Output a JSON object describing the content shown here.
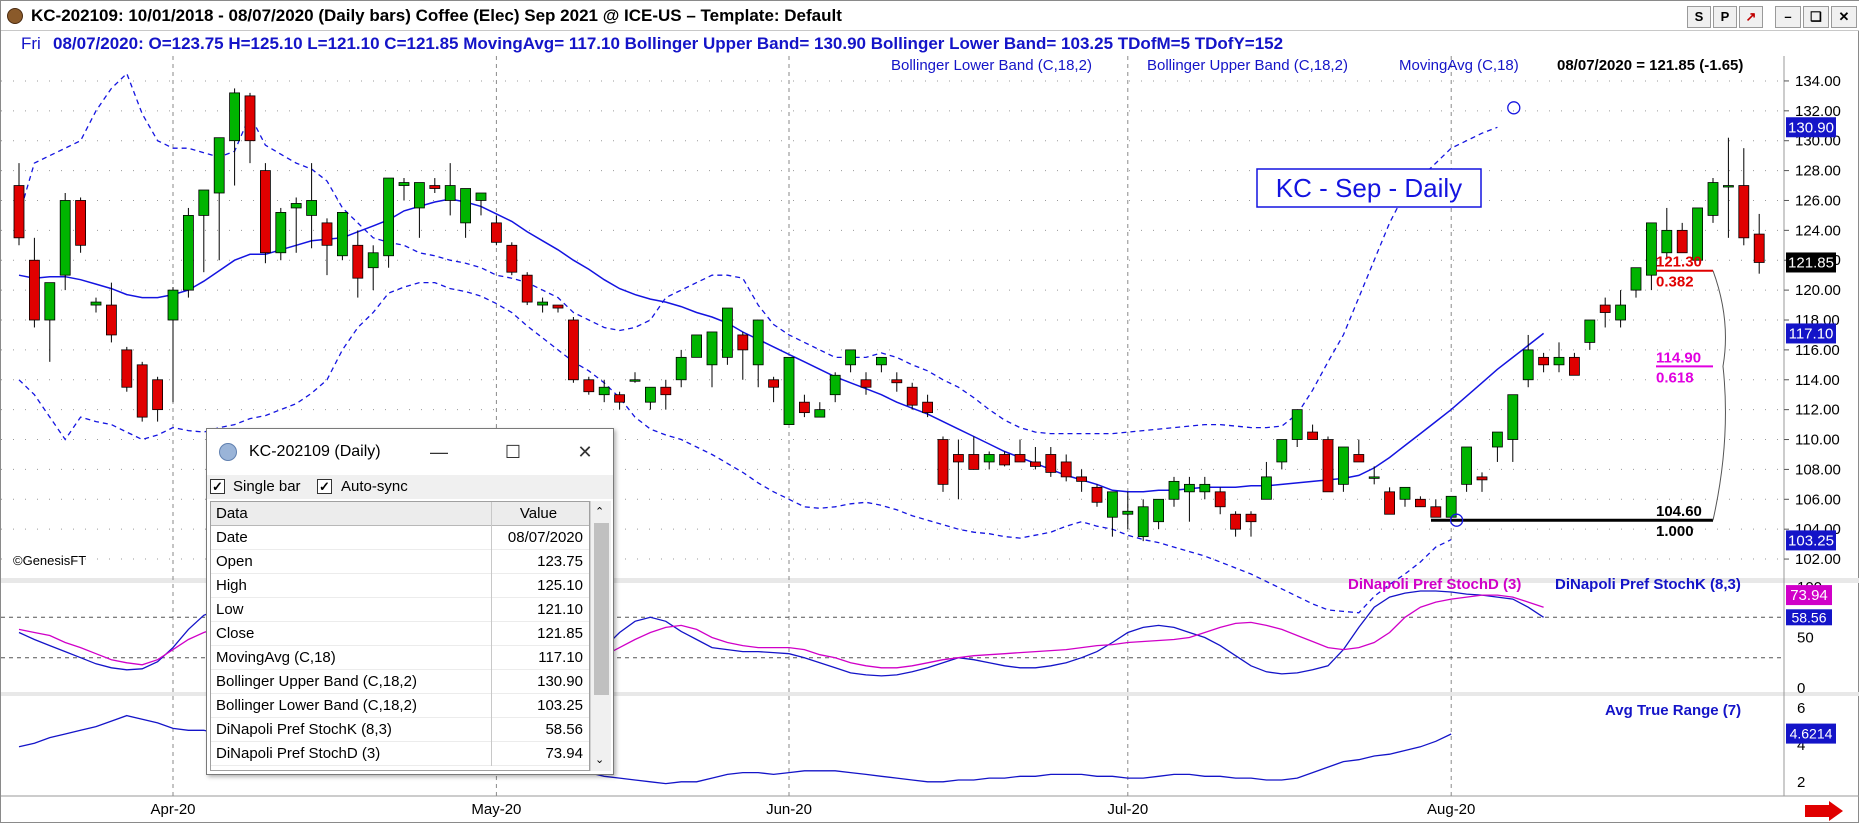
{
  "window": {
    "title": "KC-202109:  10/01/2018 - 08/07/2020  (Daily bars)   Coffee (Elec) Sep 2021 @ ICE-US  –  Template: Default",
    "buttons": [
      "S",
      "P",
      "↗",
      "–",
      "❏",
      "✕"
    ]
  },
  "infobar": {
    "day": "Fri",
    "text": "08/07/2020:  O=123.75  H=125.10  L=121.10  C=121.85  MovingAvg= 117.10  Bollinger Upper Band= 130.90  Bollinger Lower Band= 103.25  TDofM=5  TDofY=152"
  },
  "chart_data": {
    "type": "candlestick",
    "title": "KC - Sep - Daily",
    "watermark": "©GenesisFT",
    "legend": [
      "Bollinger Lower Band (C,18,2)",
      "Bollinger Upper Band (C,18,2)",
      "MovingAvg (C,18)"
    ],
    "last_label": "08/07/2020 = 121.85 (-1.65)",
    "x_labels": [
      {
        "i": 10,
        "label": "Apr-20"
      },
      {
        "i": 31,
        "label": "May-20"
      },
      {
        "i": 50,
        "label": "Jun-20"
      },
      {
        "i": 72,
        "label": "Jul-20"
      },
      {
        "i": 93,
        "label": "Aug-20"
      }
    ],
    "y_ticks": [
      102,
      104,
      106,
      108,
      110,
      112,
      114,
      116,
      118,
      120,
      122,
      124,
      126,
      128,
      130,
      132,
      134
    ],
    "ylim": [
      101,
      135
    ],
    "ohlc": [
      [
        127,
        128.5,
        123,
        123.5
      ],
      [
        122,
        123.5,
        117.5,
        118
      ],
      [
        118,
        119.5,
        115.2,
        120.5
      ],
      [
        121,
        126.5,
        120,
        126
      ],
      [
        126,
        126.2,
        122.5,
        123
      ],
      [
        119,
        119.5,
        118.5,
        119.2
      ],
      [
        119,
        120.5,
        116.5,
        117
      ],
      [
        116,
        116.2,
        113.2,
        113.5
      ],
      [
        115,
        115.2,
        111.2,
        111.5
      ],
      [
        114,
        114.2,
        111.2,
        112
      ],
      [
        118,
        120.2,
        112.5,
        120
      ],
      [
        120,
        125.5,
        119.5,
        125
      ],
      [
        125,
        126.5,
        121.2,
        126.7
      ],
      [
        126.5,
        128.5,
        122,
        130.2
      ],
      [
        130,
        133.5,
        127,
        133.2
      ],
      [
        133,
        133.2,
        128.5,
        130
      ],
      [
        128,
        128.5,
        121.8,
        122.5
      ],
      [
        122.5,
        125.5,
        122,
        125.2
      ],
      [
        125.5,
        126.2,
        122.5,
        125.8
      ],
      [
        125,
        128.5,
        122.8,
        126
      ],
      [
        124.5,
        124.8,
        121,
        123
      ],
      [
        122.3,
        124.5,
        122,
        125.2
      ],
      [
        123,
        124,
        119.5,
        120.8
      ],
      [
        121.5,
        123,
        120,
        122.5
      ],
      [
        122.3,
        124.5,
        121.5,
        127.5
      ],
      [
        127,
        127.5,
        126,
        127.2
      ],
      [
        125.5,
        127,
        123.5,
        127.2
      ],
      [
        127,
        127.5,
        126.5,
        126.8
      ],
      [
        126,
        128.5,
        125,
        127
      ],
      [
        124.5,
        126.5,
        123.5,
        126.8
      ],
      [
        126,
        126.2,
        125,
        126.5
      ],
      [
        124.5,
        125,
        123,
        123.2
      ],
      [
        123,
        123.2,
        121,
        121.2
      ],
      [
        121,
        121.2,
        119,
        119.2
      ],
      [
        119,
        119.5,
        118.5,
        119.2
      ],
      [
        119,
        119,
        118.5,
        118.8
      ],
      [
        118,
        118.2,
        113.8,
        114
      ],
      [
        114,
        114.2,
        113,
        113.2
      ],
      [
        113,
        114,
        112.5,
        113.5
      ],
      [
        113,
        113.2,
        112,
        112.5
      ],
      [
        114,
        114.5,
        113.8,
        114
      ],
      [
        112.5,
        113.5,
        112,
        113.5
      ],
      [
        113.5,
        114,
        112,
        113
      ],
      [
        114,
        116,
        113.5,
        115.5
      ],
      [
        115.5,
        116.5,
        116,
        117
      ],
      [
        115,
        116,
        113.5,
        117.2
      ],
      [
        115.5,
        118.5,
        115,
        118.8
      ],
      [
        117,
        117.2,
        114,
        116
      ],
      [
        115,
        115.2,
        113.5,
        118
      ],
      [
        114,
        114.2,
        112.5,
        113.5
      ],
      [
        111,
        113,
        111,
        115.5
      ],
      [
        112.5,
        113,
        111.5,
        111.8
      ],
      [
        111.5,
        112.5,
        111.5,
        112
      ],
      [
        113,
        114.5,
        112.5,
        114.3
      ],
      [
        115,
        115.5,
        114.5,
        116
      ],
      [
        114,
        114.5,
        113,
        113.5
      ],
      [
        115,
        115.5,
        114.5,
        115.5
      ],
      [
        114,
        114.5,
        113.2,
        113.8
      ],
      [
        113.5,
        113.8,
        112,
        112.3
      ],
      [
        112.5,
        113,
        111.5,
        111.8
      ],
      [
        110,
        110.2,
        106.5,
        107
      ],
      [
        109,
        110,
        106,
        108.5
      ],
      [
        109,
        110.2,
        108,
        108
      ],
      [
        108.5,
        109.2,
        108,
        109
      ],
      [
        109,
        109.2,
        108.2,
        108.3
      ],
      [
        109,
        110,
        108.5,
        108.5
      ],
      [
        108.5,
        109.5,
        108,
        108.2
      ],
      [
        109,
        109.5,
        107.5,
        107.8
      ],
      [
        108.5,
        109,
        107.2,
        107.5
      ],
      [
        107.5,
        108,
        106.5,
        107.2
      ],
      [
        106.8,
        107,
        105.5,
        105.8
      ],
      [
        104.8,
        106,
        103.5,
        106.5
      ],
      [
        105,
        106.5,
        104,
        105.2
      ],
      [
        103.5,
        106,
        103.2,
        105.5
      ],
      [
        104.5,
        105.5,
        104,
        106
      ],
      [
        106,
        107.5,
        105.5,
        107.2
      ],
      [
        106.5,
        107.5,
        104.5,
        107
      ],
      [
        106.5,
        107.5,
        106,
        107
      ],
      [
        106.5,
        106.8,
        105,
        105.5
      ],
      [
        105,
        105.2,
        103.5,
        104
      ],
      [
        105,
        105.2,
        103.5,
        104.5
      ],
      [
        106,
        108.5,
        106,
        107.5
      ],
      [
        108.5,
        109,
        108,
        110
      ],
      [
        110,
        111.5,
        109.5,
        112
      ],
      [
        110.5,
        111,
        110,
        110
      ],
      [
        110,
        110.2,
        106.5,
        106.5
      ],
      [
        107,
        109.5,
        106.5,
        109.5
      ],
      [
        109,
        110,
        108.5,
        108.5
      ],
      [
        107.5,
        108.2,
        107,
        107.5
      ],
      [
        106.5,
        106.8,
        105.5,
        105
      ],
      [
        106,
        106.5,
        105.5,
        106.8
      ],
      [
        106,
        106.2,
        105.5,
        105.5
      ],
      [
        105.5,
        106,
        104.8,
        104.8
      ],
      [
        104.8,
        106,
        104.6,
        106.2
      ],
      [
        107,
        108.5,
        106.5,
        109.5
      ],
      [
        107.5,
        107.8,
        106.5,
        107.3
      ],
      [
        109.5,
        110.5,
        108.5,
        110.5
      ],
      [
        110,
        111,
        108.5,
        113
      ],
      [
        114,
        117,
        113.5,
        116
      ],
      [
        115.5,
        115.8,
        114.5,
        115
      ],
      [
        115,
        116.5,
        114.5,
        115.5
      ],
      [
        115.5,
        115.8,
        114.5,
        114.3
      ],
      [
        116.5,
        117.5,
        116,
        118
      ],
      [
        119,
        119.5,
        117.5,
        118.5
      ],
      [
        118,
        120,
        117.5,
        119
      ],
      [
        120,
        120.5,
        119.5,
        121.5
      ],
      [
        121,
        122.8,
        120,
        124.5
      ],
      [
        122.5,
        125.5,
        122.2,
        124
      ],
      [
        124,
        124.5,
        122.5,
        122.5
      ],
      [
        122,
        124.5,
        122.5,
        125.5
      ],
      [
        125,
        127.5,
        124.5,
        127.2
      ],
      [
        127,
        130.2,
        123.5,
        127
      ],
      [
        127,
        129.5,
        123,
        123.5
      ],
      [
        123.75,
        125.1,
        121.1,
        121.85
      ]
    ],
    "moving_avg": [
      121,
      120.8,
      120.9,
      120.9,
      120.7,
      120.4,
      120.1,
      119.7,
      119.5,
      119.5,
      119.7,
      120,
      120.6,
      121.3,
      122,
      122.4,
      122.4,
      122.7,
      123,
      123.3,
      123.4,
      123.5,
      123.9,
      124.3,
      124.7,
      125.3,
      125.6,
      125.9,
      126.1,
      125.9,
      125.6,
      125.1,
      124.6,
      123.9,
      123.3,
      122.7,
      122,
      121.4,
      120.7,
      120.1,
      119.7,
      119.4,
      119.2,
      118.9,
      118.5,
      118.2,
      117.8,
      117.2,
      116.7,
      116.2,
      115.7,
      115.2,
      114.7,
      114.2,
      113.8,
      113.4,
      113,
      112.5,
      112.1,
      111.7,
      111.2,
      110.7,
      110.2,
      109.7,
      109.2,
      108.8,
      108.4,
      108,
      107.6,
      107.3,
      107,
      106.6,
      106.5,
      106.5,
      106.6,
      106.6,
      106.7,
      106.8,
      106.8,
      106.8,
      106.9,
      106.9,
      107,
      107.1,
      107.2,
      107.3,
      107.4,
      107.6,
      108.1,
      108.8,
      109.6,
      110.4,
      111.2,
      112,
      112.9,
      113.8,
      114.7,
      115.5,
      116.3,
      117.1
    ],
    "upper_band": [
      125,
      128.5,
      129,
      129.5,
      130,
      132,
      133.5,
      134.5,
      131.8,
      130,
      129.5,
      129.5,
      129.2,
      128.9,
      129.3,
      131.7,
      129.7,
      129.1,
      128.5,
      128.1,
      127.3,
      125.5,
      124.5,
      123.5,
      123.2,
      123,
      122.5,
      122.3,
      122,
      121.8,
      121.5,
      121,
      120.8,
      120.5,
      120,
      119.5,
      118.5,
      118,
      117.5,
      117.3,
      117.5,
      118,
      119.5,
      120,
      120.5,
      121,
      121,
      120.8,
      119,
      117.7,
      117,
      116.5,
      116,
      115.5,
      115.5,
      115.5,
      115.8,
      115.5,
      115,
      114.6,
      114,
      113.5,
      112.8,
      112,
      111.3,
      110.8,
      110.5,
      110.4,
      110.4,
      110.4,
      110.4,
      110.4,
      110.5,
      110.6,
      110.7,
      110.8,
      110.9,
      111,
      111,
      110.9,
      110.8,
      110.8,
      110.9,
      111.7,
      113.3,
      115.2,
      117,
      119.5,
      122,
      124.5,
      126.5,
      127.5,
      128.5,
      129.5,
      130,
      130.5,
      130.9
    ],
    "lower_band": [
      114,
      113,
      111.5,
      110,
      111.5,
      111.2,
      111,
      110.5,
      110,
      110.3,
      110.8,
      110.6,
      110.5,
      110.8,
      111,
      111.4,
      111.6,
      112,
      112.4,
      113.1,
      114,
      116,
      117.5,
      118.5,
      119.8,
      120.2,
      120.5,
      120.5,
      120.1,
      119.9,
      119.6,
      119.1,
      118.5,
      117.6,
      116.8,
      116,
      115.2,
      114.6,
      113.8,
      112.8,
      111.5,
      110.7,
      110.3,
      110,
      109.5,
      109,
      108.4,
      107.8,
      107.1,
      106.5,
      106,
      105.5,
      105.4,
      105.5,
      105.7,
      105.8,
      105.6,
      105.3,
      104.9,
      104.6,
      104.3,
      104,
      103.8,
      103.7,
      103.5,
      103.4,
      103.6,
      103.8,
      104.2,
      104.5,
      104.2,
      104,
      103.6,
      103.3,
      103.1,
      102.8,
      102.5,
      102.2,
      101.8,
      101.4,
      101,
      100.5,
      100,
      99.5,
      99,
      98.6,
      98.5,
      98.4,
      99.5,
      100.3,
      101,
      101.8,
      102.8,
      103.3
    ],
    "fib": [
      {
        "value": 121.3,
        "ratio": "0.382",
        "color": "#e00000"
      },
      {
        "value": 114.9,
        "ratio": "0.618",
        "color": "#e000e0"
      },
      {
        "value": 104.6,
        "ratio": "1.000",
        "color": "#000000"
      }
    ],
    "price_tags": [
      {
        "value": 130.9,
        "label": "130.90",
        "bg": "#1414c8"
      },
      {
        "value": 121.85,
        "label": "121.85",
        "bg": "#000000"
      },
      {
        "value": 117.1,
        "label": "117.10",
        "bg": "#1414c8"
      },
      {
        "value": 103.25,
        "label": "103.25",
        "bg": "#1414c8"
      }
    ],
    "stoch": {
      "legend_d": "DiNapoli Pref StochD (3)",
      "legend_k": "DiNapoli Pref StochK (8,3)",
      "y_ticks": [
        0,
        50,
        100
      ],
      "levels": [
        30,
        70
      ],
      "d": [
        58,
        55,
        52,
        45,
        40,
        34,
        28,
        25,
        23,
        28,
        38,
        48,
        55,
        60,
        62,
        64,
        65,
        60,
        55,
        52,
        50,
        48,
        45,
        44,
        45,
        46,
        47,
        46,
        45,
        44,
        42,
        40,
        35,
        30,
        25,
        22,
        22,
        25,
        32,
        40,
        48,
        55,
        60,
        62,
        58,
        50,
        45,
        42,
        40,
        40,
        40,
        38,
        33,
        30,
        25,
        22,
        20,
        20,
        22,
        25,
        28,
        30,
        32,
        33,
        34,
        35,
        36,
        37,
        38,
        40,
        42,
        43,
        45,
        46,
        47,
        48,
        50,
        55,
        60,
        64,
        65,
        62,
        58,
        52,
        46,
        40,
        38,
        40,
        45,
        55,
        70,
        80,
        85,
        88,
        90,
        92,
        92,
        90,
        85,
        80
      ],
      "k": [
        55,
        48,
        42,
        36,
        30,
        24,
        20,
        18,
        19,
        26,
        40,
        58,
        72,
        78,
        74,
        68,
        62,
        55,
        50,
        45,
        42,
        40,
        38,
        40,
        45,
        48,
        50,
        48,
        45,
        42,
        38,
        33,
        26,
        20,
        14,
        12,
        15,
        26,
        40,
        55,
        66,
        70,
        66,
        56,
        48,
        40,
        38,
        36,
        36,
        35,
        34,
        30,
        25,
        20,
        15,
        13,
        12,
        13,
        16,
        20,
        25,
        30,
        28,
        25,
        22,
        20,
        20,
        22,
        25,
        30,
        36,
        45,
        55,
        60,
        62,
        60,
        55,
        50,
        42,
        32,
        22,
        16,
        14,
        15,
        18,
        22,
        38,
        60,
        80,
        90,
        94,
        96,
        96,
        95,
        93,
        92,
        90,
        88,
        80,
        70
      ]
    },
    "atr": {
      "legend": "Avg True Range (7)",
      "y_ticks": [
        2,
        4,
        6
      ],
      "last": "4.6214",
      "values": [
        3.9,
        4.1,
        4.4,
        4.6,
        4.8,
        5.0,
        5.3,
        5.6,
        5.4,
        5.2,
        4.9,
        4.8,
        4.8,
        4.6,
        4.3,
        4.3,
        4.3,
        4.4,
        4.4,
        4.5,
        4.4,
        4.3,
        4.1,
        4.0,
        4.0,
        3.9,
        3.7,
        3.6,
        3.5,
        3.5,
        3.4,
        3.3,
        3.2,
        3.1,
        3.0,
        2.9,
        2.7,
        2.5,
        2.3,
        2.2,
        2.1,
        2.0,
        1.9,
        2.0,
        2.0,
        2.2,
        2.4,
        2.5,
        2.5,
        2.4,
        2.5,
        2.6,
        2.6,
        2.6,
        2.5,
        2.4,
        2.3,
        2.2,
        2.1,
        2.0,
        2.0,
        2.1,
        2.1,
        2.2,
        2.2,
        2.3,
        2.3,
        2.4,
        2.4,
        2.4,
        2.3,
        2.3,
        2.2,
        2.2,
        2.3,
        2.4,
        2.4,
        2.3,
        2.3,
        2.2,
        2.2,
        2.1,
        2.1,
        2.2,
        2.5,
        2.8,
        3.1,
        3.2,
        3.4,
        3.5,
        3.7,
        3.9,
        4.2,
        4.6
      ]
    }
  },
  "dialog": {
    "title": "KC-202109 (Daily)",
    "single_bar": "Single bar",
    "auto_sync": "Auto-sync",
    "col_data": "Data",
    "col_value": "Value",
    "rows": [
      {
        "name": "Date",
        "value": "08/07/2020"
      },
      {
        "name": "Open",
        "value": "123.75"
      },
      {
        "name": "High",
        "value": "125.10"
      },
      {
        "name": "Low",
        "value": "121.10"
      },
      {
        "name": "Close",
        "value": "121.85"
      },
      {
        "name": "MovingAvg (C,18)",
        "value": "117.10"
      },
      {
        "name": "Bollinger Upper Band (C,18,2)",
        "value": "130.90"
      },
      {
        "name": "Bollinger Lower Band (C,18,2)",
        "value": "103.25"
      },
      {
        "name": "DiNapoli Pref StochK (8,3)",
        "value": "58.56"
      },
      {
        "name": "DiNapoli Pref StochD (3)",
        "value": "73.94"
      }
    ]
  }
}
